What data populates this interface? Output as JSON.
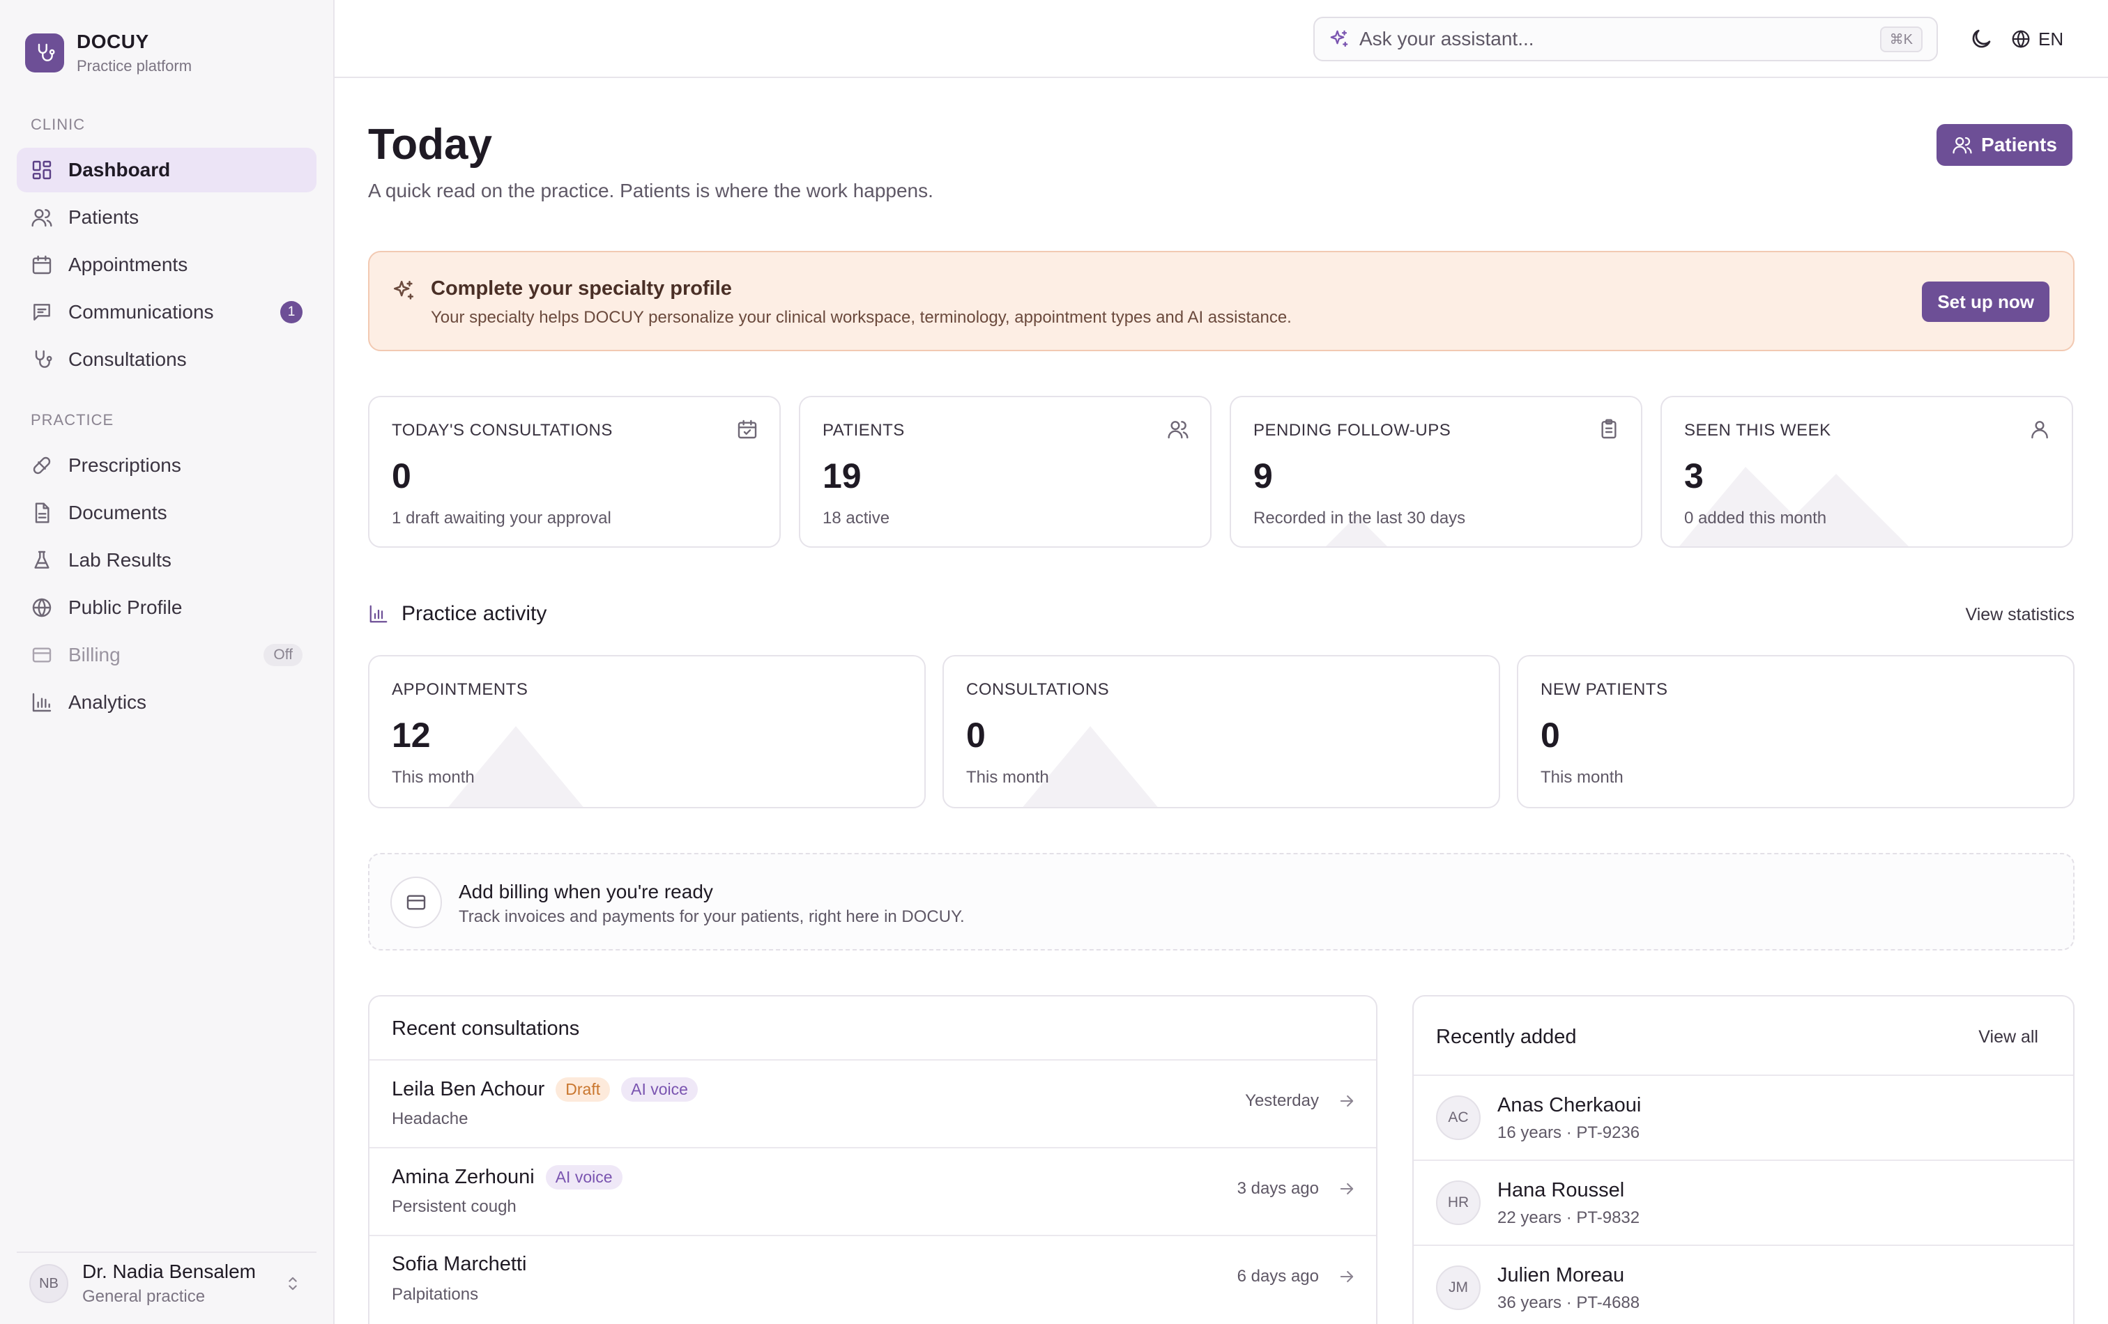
{
  "brand": {
    "name": "DOCUY",
    "subtitle": "Practice platform"
  },
  "sidebar": {
    "clinic_label": "CLINIC",
    "practice_label": "PRACTICE",
    "clinic_items": [
      {
        "label": "Dashboard",
        "icon": "dashboard-icon",
        "active": true
      },
      {
        "label": "Patients",
        "icon": "users-icon"
      },
      {
        "label": "Appointments",
        "icon": "calendar-icon"
      },
      {
        "label": "Communications",
        "icon": "message-icon",
        "badge": "1"
      },
      {
        "label": "Consultations",
        "icon": "stethoscope-icon"
      }
    ],
    "practice_items": [
      {
        "label": "Prescriptions",
        "icon": "pill-icon"
      },
      {
        "label": "Documents",
        "icon": "file-icon"
      },
      {
        "label": "Lab Results",
        "icon": "flask-icon"
      },
      {
        "label": "Public Profile",
        "icon": "globe-icon"
      },
      {
        "label": "Billing",
        "icon": "credit-card-icon",
        "status": "Off"
      },
      {
        "label": "Analytics",
        "icon": "bar-chart-icon"
      }
    ],
    "user": {
      "initials": "NB",
      "name": "Dr. Nadia Bensalem",
      "role": "General practice"
    }
  },
  "topbar": {
    "assistant_placeholder": "Ask your assistant...",
    "shortcut": "⌘K",
    "language": "EN"
  },
  "page": {
    "title": "Today",
    "subtitle": "A quick read on the practice. Patients is where the work happens.",
    "patients_button": "Patients"
  },
  "banner": {
    "title": "Complete your specialty profile",
    "text": "Your specialty helps DOCUY personalize your clinical workspace, terminology, appointment types and AI assistance.",
    "button": "Set up now"
  },
  "stats": [
    {
      "label": "TODAY'S CONSULTATIONS",
      "value": "0",
      "note": "1 draft awaiting your approval",
      "icon": "calendar-check-icon"
    },
    {
      "label": "PATIENTS",
      "value": "19",
      "note": "18 active",
      "icon": "users-icon"
    },
    {
      "label": "PENDING FOLLOW-UPS",
      "value": "9",
      "note": "Recorded in the last 30 days",
      "icon": "clipboard-icon"
    },
    {
      "label": "SEEN THIS WEEK",
      "value": "3",
      "note": "0 added this month",
      "icon": "user-icon"
    }
  ],
  "activity": {
    "title": "Practice activity",
    "view_statistics": "View statistics",
    "cards": [
      {
        "label": "APPOINTMENTS",
        "value": "12",
        "note": "This month"
      },
      {
        "label": "CONSULTATIONS",
        "value": "0",
        "note": "This month"
      },
      {
        "label": "NEW PATIENTS",
        "value": "0",
        "note": "This month"
      }
    ]
  },
  "billing": {
    "title": "Add billing when you're ready",
    "text": "Track invoices and payments for your patients, right here in DOCUY."
  },
  "recent_consultations": {
    "title": "Recent consultations",
    "rows": [
      {
        "name": "Leila Ben Achour",
        "tags": [
          "Draft",
          "AI voice"
        ],
        "reason": "Headache",
        "time": "Yesterday"
      },
      {
        "name": "Amina Zerhouni",
        "tags": [
          "AI voice"
        ],
        "reason": "Persistent cough",
        "time": "3 days ago"
      },
      {
        "name": "Sofia Marchetti",
        "tags": [],
        "reason": "Palpitations",
        "time": "6 days ago"
      }
    ]
  },
  "recently_added": {
    "title": "Recently added",
    "view_all": "View all",
    "patients": [
      {
        "initials": "AC",
        "name": "Anas Cherkaoui",
        "meta": "16 years · PT-9236"
      },
      {
        "initials": "HR",
        "name": "Hana Roussel",
        "meta": "22 years · PT-9832"
      },
      {
        "initials": "JM",
        "name": "Julien Moreau",
        "meta": "36 years · PT-4688"
      }
    ]
  }
}
